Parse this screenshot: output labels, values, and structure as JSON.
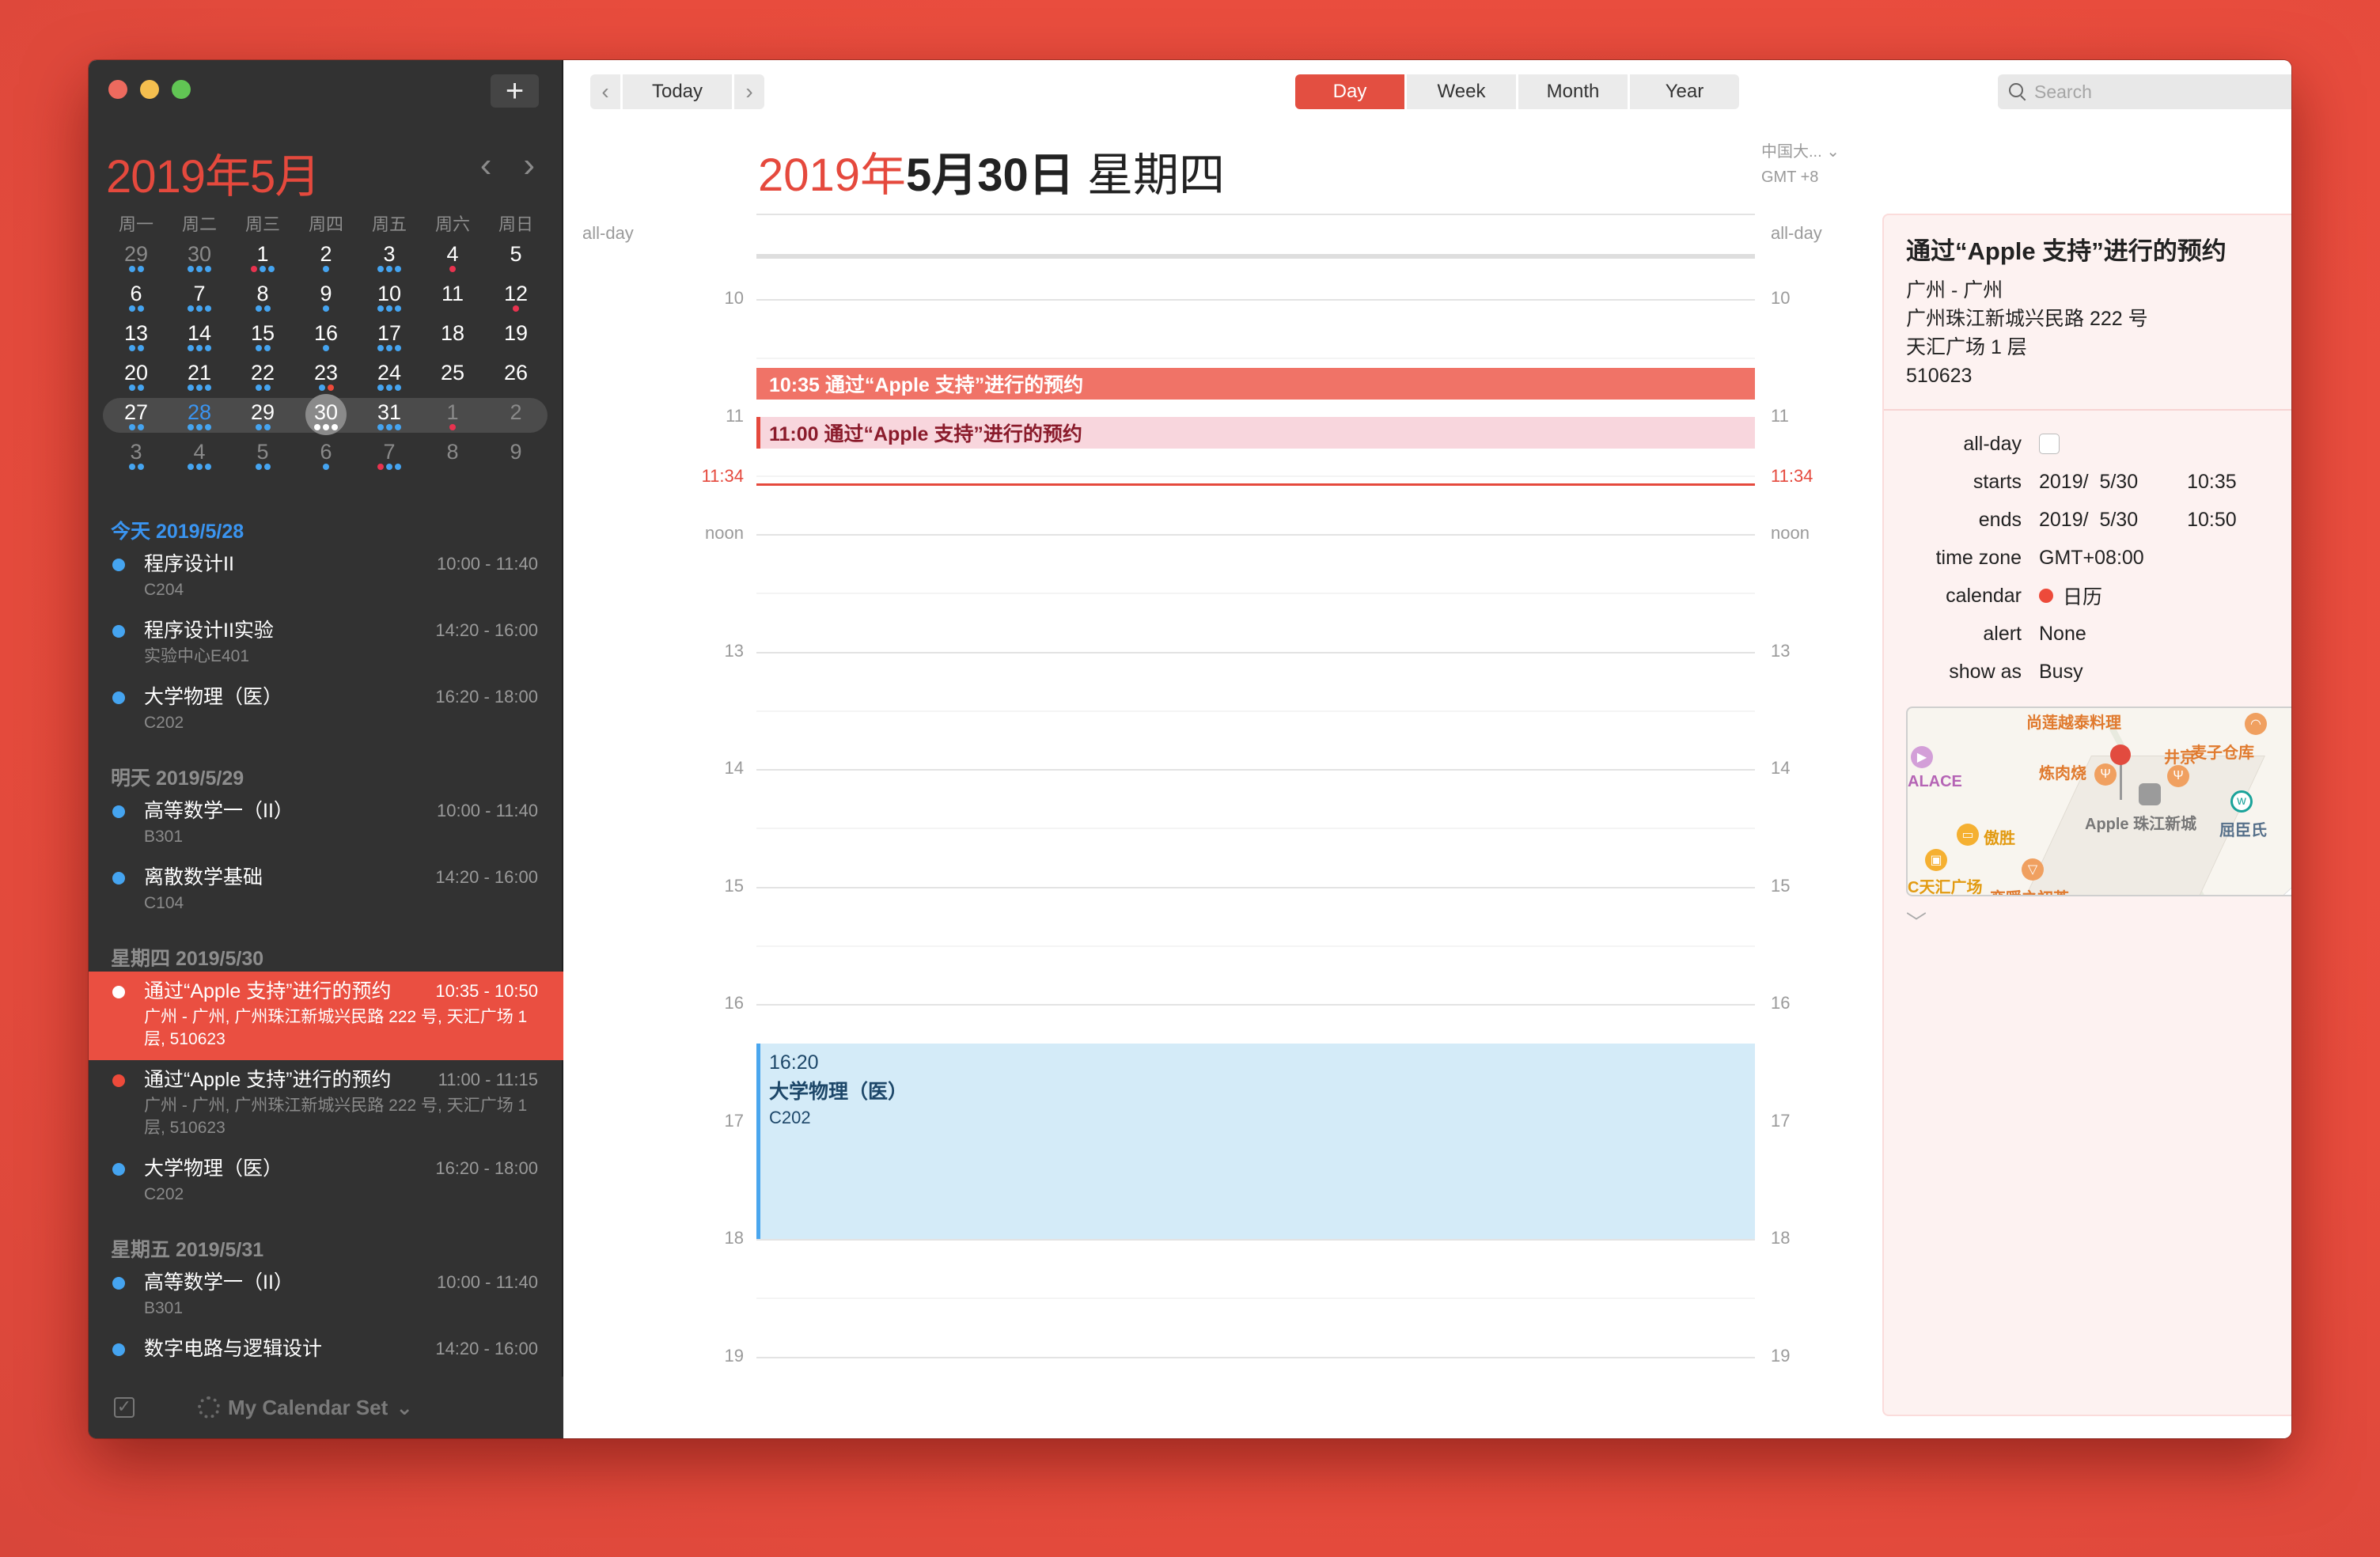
{
  "window": {
    "add_label": "+"
  },
  "sidebar": {
    "month_title": "2019年5月",
    "nav_prev": "‹",
    "nav_next": "›",
    "weekdays": [
      "周一",
      "周二",
      "周三",
      "周四",
      "周五",
      "周六",
      "周日"
    ],
    "weeks": [
      [
        {
          "d": "29",
          "dim": true,
          "dots": [
            "blue",
            "blue"
          ]
        },
        {
          "d": "30",
          "dim": true,
          "dots": [
            "blue",
            "blue",
            "blue"
          ]
        },
        {
          "d": "1",
          "dots": [
            "red",
            "blue",
            "blue"
          ]
        },
        {
          "d": "2",
          "dots": [
            "blue"
          ]
        },
        {
          "d": "3",
          "dots": [
            "blue",
            "blue",
            "blue"
          ]
        },
        {
          "d": "4",
          "dots": [
            "red"
          ]
        },
        {
          "d": "5",
          "dots": []
        }
      ],
      [
        {
          "d": "6",
          "dots": [
            "blue",
            "blue"
          ]
        },
        {
          "d": "7",
          "dots": [
            "blue",
            "blue",
            "blue"
          ]
        },
        {
          "d": "8",
          "dots": [
            "blue",
            "blue"
          ]
        },
        {
          "d": "9",
          "dots": [
            "blue"
          ]
        },
        {
          "d": "10",
          "dots": [
            "blue",
            "blue",
            "blue"
          ]
        },
        {
          "d": "11",
          "dots": []
        },
        {
          "d": "12",
          "dots": [
            "red"
          ]
        }
      ],
      [
        {
          "d": "13",
          "dots": [
            "blue",
            "blue"
          ]
        },
        {
          "d": "14",
          "dots": [
            "blue",
            "blue",
            "blue"
          ]
        },
        {
          "d": "15",
          "dots": [
            "blue",
            "blue"
          ]
        },
        {
          "d": "16",
          "dots": [
            "blue"
          ]
        },
        {
          "d": "17",
          "dots": [
            "blue",
            "blue",
            "blue"
          ]
        },
        {
          "d": "18",
          "dots": []
        },
        {
          "d": "19",
          "dots": []
        }
      ],
      [
        {
          "d": "20",
          "dots": [
            "blue",
            "blue"
          ]
        },
        {
          "d": "21",
          "dots": [
            "blue",
            "blue",
            "blue"
          ]
        },
        {
          "d": "22",
          "dots": [
            "blue",
            "blue"
          ]
        },
        {
          "d": "23",
          "dots": [
            "blue",
            "orange"
          ]
        },
        {
          "d": "24",
          "dots": [
            "blue",
            "blue",
            "blue"
          ]
        },
        {
          "d": "25",
          "dots": []
        },
        {
          "d": "26",
          "dots": []
        }
      ],
      [
        {
          "d": "27",
          "dots": [
            "blue",
            "blue"
          ]
        },
        {
          "d": "28",
          "today": true,
          "dots": [
            "blue",
            "blue",
            "blue"
          ]
        },
        {
          "d": "29",
          "dots": [
            "blue",
            "blue"
          ]
        },
        {
          "d": "30",
          "selected": true,
          "dots": [
            "white",
            "white",
            "white"
          ]
        },
        {
          "d": "31",
          "dots": [
            "blue",
            "blue",
            "blue"
          ]
        },
        {
          "d": "1",
          "dim": true,
          "dots": [
            "red"
          ]
        },
        {
          "d": "2",
          "dim": true,
          "dots": []
        }
      ],
      [
        {
          "d": "3",
          "dim": true,
          "dots": [
            "blue",
            "blue"
          ]
        },
        {
          "d": "4",
          "dim": true,
          "dots": [
            "blue",
            "blue",
            "blue"
          ]
        },
        {
          "d": "5",
          "dim": true,
          "dots": [
            "blue",
            "blue"
          ]
        },
        {
          "d": "6",
          "dim": true,
          "dots": [
            "blue"
          ]
        },
        {
          "d": "7",
          "dim": true,
          "dots": [
            "red",
            "blue",
            "blue"
          ]
        },
        {
          "d": "8",
          "dim": true,
          "dots": []
        },
        {
          "d": "9",
          "dim": true,
          "dots": []
        }
      ]
    ],
    "agenda": [
      {
        "header": "今天 2019/5/28",
        "is_today": true,
        "items": [
          {
            "title": "程序设计II",
            "time": "10:00 - 11:40",
            "sub": "C204",
            "color": "#45a4f0"
          },
          {
            "title": "程序设计II实验",
            "time": "14:20 - 16:00",
            "sub": "实验中心E401",
            "color": "#45a4f0"
          },
          {
            "title": "大学物理（医）",
            "time": "16:20 - 18:00",
            "sub": "C202",
            "color": "#45a4f0"
          }
        ]
      },
      {
        "header": "明天 2019/5/29",
        "items": [
          {
            "title": "高等数学一（II）",
            "time": "10:00 - 11:40",
            "sub": "B301",
            "color": "#45a4f0"
          },
          {
            "title": "离散数学基础",
            "time": "14:20 - 16:00",
            "sub": "C104",
            "color": "#45a4f0"
          }
        ]
      },
      {
        "header": "星期四 2019/5/30",
        "items": [
          {
            "title": "通过“Apple 支持”进行的预约",
            "time": "10:35 - 10:50",
            "sub": "广州 - 广州, 广州珠江新城兴民路 222 号, 天汇广场 1 层, 510623",
            "color": "#ffffff",
            "selected": true
          },
          {
            "title": "通过“Apple 支持”进行的预约",
            "time": "11:00 - 11:15",
            "sub": "广州 - 广州, 广州珠江新城兴民路 222 号, 天汇广场 1 层, 510623",
            "color": "#ed4a3a"
          },
          {
            "title": "大学物理（医）",
            "time": "16:20 - 18:00",
            "sub": "C202",
            "color": "#45a4f0"
          }
        ]
      },
      {
        "header": "星期五 2019/5/31",
        "items": [
          {
            "title": "高等数学一（II）",
            "time": "10:00 - 11:40",
            "sub": "B301",
            "color": "#45a4f0"
          },
          {
            "title": "数字电路与逻辑设计",
            "time": "14:20 - 16:00",
            "sub": "",
            "color": "#45a4f0"
          }
        ]
      }
    ],
    "footer": {
      "calendar_set": "My Calendar Set",
      "chevron": "⌄"
    }
  },
  "toolbar": {
    "prev": "‹",
    "today": "Today",
    "next": "›",
    "views": [
      "Day",
      "Week",
      "Month",
      "Year"
    ],
    "active_view": "Day",
    "search_placeholder": "Search"
  },
  "day_view": {
    "title_year": "2019年",
    "title_monthday": "5月30日",
    "title_weekday": "星期四",
    "timezone_name": "中国大...",
    "timezone_offset": "GMT +8",
    "allday_label": "all-day",
    "hours": [
      {
        "label": "10",
        "h": 10
      },
      {
        "label": "11",
        "h": 11
      },
      {
        "label": "noon",
        "h": 12
      },
      {
        "label": "13",
        "h": 13
      },
      {
        "label": "14",
        "h": 14
      },
      {
        "label": "15",
        "h": 15
      },
      {
        "label": "16",
        "h": 16
      },
      {
        "label": "17",
        "h": 17
      },
      {
        "label": "18",
        "h": 18
      },
      {
        "label": "19",
        "h": 19
      }
    ],
    "now_label": "11:34",
    "now_time": 11.567,
    "events": [
      {
        "kind": "solid",
        "start": "10:35",
        "end": "10:50",
        "label": "10:35 通过“Apple 支持”进行的预约"
      },
      {
        "kind": "pale",
        "start": "11:00",
        "end": "11:15",
        "label": "11:00 通过“Apple 支持”进行的预约"
      },
      {
        "kind": "blue",
        "start": "16:20",
        "end": "18:00",
        "time": "16:20",
        "name": "大学物理（医）",
        "location": "C202"
      }
    ]
  },
  "detail": {
    "title": "通过“Apple 支持”进行的预约",
    "address": [
      "广州 - 广州",
      "广州珠江新城兴民路 222 号",
      "天汇广场 1 层",
      "510623"
    ],
    "rows": {
      "allday_label": "all-day",
      "allday_checked": false,
      "starts_label": "starts",
      "starts_date": "2019/  5/30",
      "starts_time": "10:35",
      "ends_label": "ends",
      "ends_date": "2019/  5/30",
      "ends_time": "10:50",
      "timezone_label": "time zone",
      "timezone_value": "GMT+08:00",
      "calendar_label": "calendar",
      "calendar_value": "日历",
      "calendar_color": "#ed4a3a",
      "alert_label": "alert",
      "alert_value": "None",
      "showas_label": "show as",
      "showas_value": "Busy"
    },
    "map": {
      "pois": [
        "尚莲越泰料理",
        "麦子仓库",
        "井京",
        "炼肉烧",
        "ALACE",
        "Apple 珠江新城",
        "屈臣氏",
        "傲胜",
        "C天汇广场",
        "恋暖之初茶"
      ]
    },
    "expand_chevron": "﹀"
  }
}
